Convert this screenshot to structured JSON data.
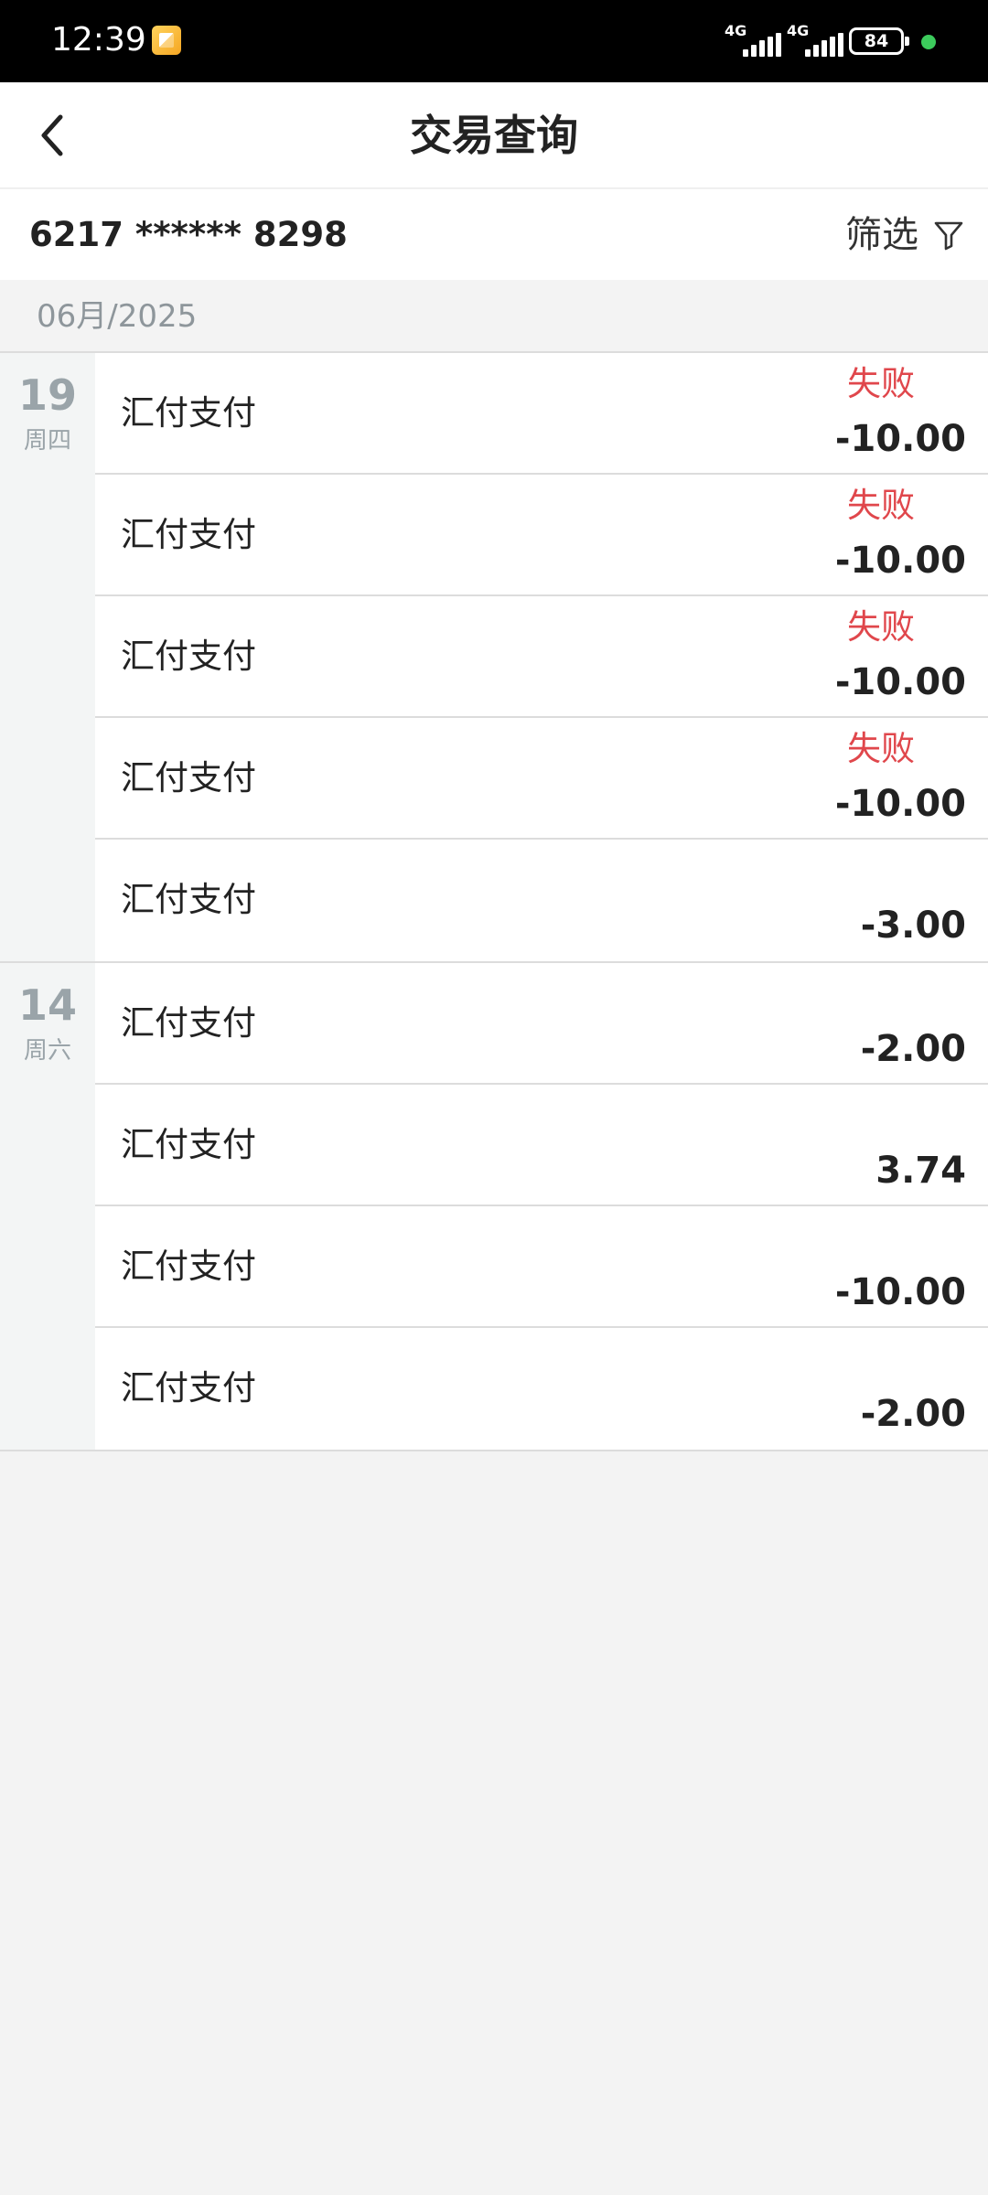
{
  "status_bar": {
    "time": "12:39",
    "signal_1": "4G",
    "signal_2": "4G",
    "battery": "84"
  },
  "header": {
    "back_icon": "chevron-left-icon",
    "title": "交易查询"
  },
  "account": {
    "number": "6217 ****** 8298",
    "filter_label": "筛选",
    "filter_icon": "funnel-icon"
  },
  "month": {
    "label": "06月/2025"
  },
  "groups": [
    {
      "day": "19",
      "weekday": "周四",
      "items": [
        {
          "name": "汇付支付",
          "status": "失败",
          "amount": "-10.00"
        },
        {
          "name": "汇付支付",
          "status": "失败",
          "amount": "-10.00"
        },
        {
          "name": "汇付支付",
          "status": "失败",
          "amount": "-10.00"
        },
        {
          "name": "汇付支付",
          "status": "失败",
          "amount": "-10.00"
        },
        {
          "name": "汇付支付",
          "status": "",
          "amount": "-3.00"
        }
      ]
    },
    {
      "day": "14",
      "weekday": "周六",
      "items": [
        {
          "name": "汇付支付",
          "status": "",
          "amount": "-2.00"
        },
        {
          "name": "汇付支付",
          "status": "",
          "amount": "3.74"
        },
        {
          "name": "汇付支付",
          "status": "",
          "amount": "-10.00"
        },
        {
          "name": "汇付支付",
          "status": "",
          "amount": "-2.00"
        }
      ]
    }
  ],
  "colors": {
    "status_fail": "#e0474c",
    "status_bar_bg": "#000000",
    "page_bg": "#f3f3f3"
  }
}
